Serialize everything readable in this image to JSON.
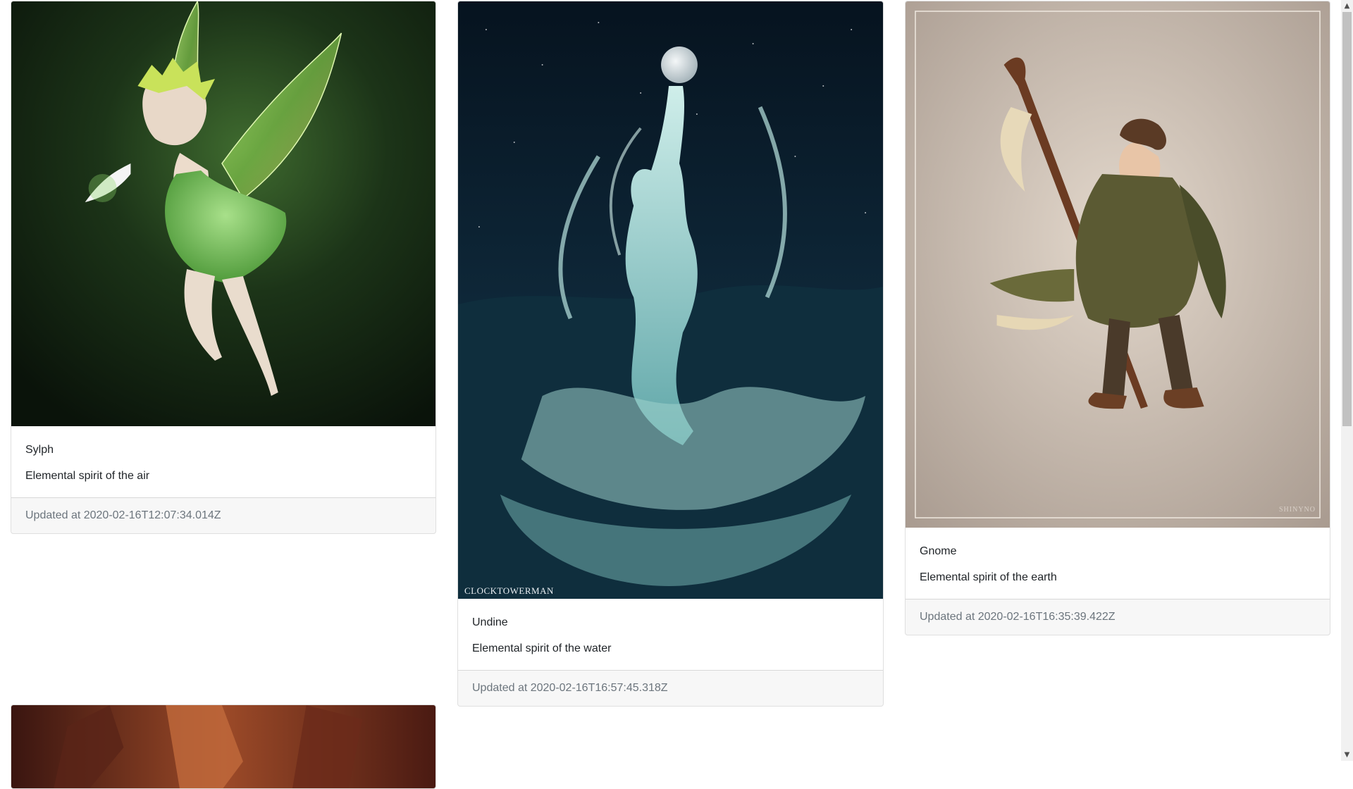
{
  "cards": [
    {
      "title": "Sylph",
      "text": "Elemental spirit of the air",
      "footer": "Updated at 2020-02-16T12:07:34.014Z"
    },
    {
      "title": "Undine",
      "text": "Elemental spirit of the water",
      "footer": "Updated at 2020-02-16T16:57:45.318Z",
      "watermark": "CLOCKTOWERMAN"
    },
    {
      "title": "Gnome",
      "text": "Elemental spirit of the earth",
      "footer": "Updated at 2020-02-16T16:35:39.422Z",
      "signature": "SHINYNO"
    }
  ],
  "scrollbar": {
    "up_icon": "chevron-up-icon",
    "down_icon": "chevron-down-icon"
  }
}
